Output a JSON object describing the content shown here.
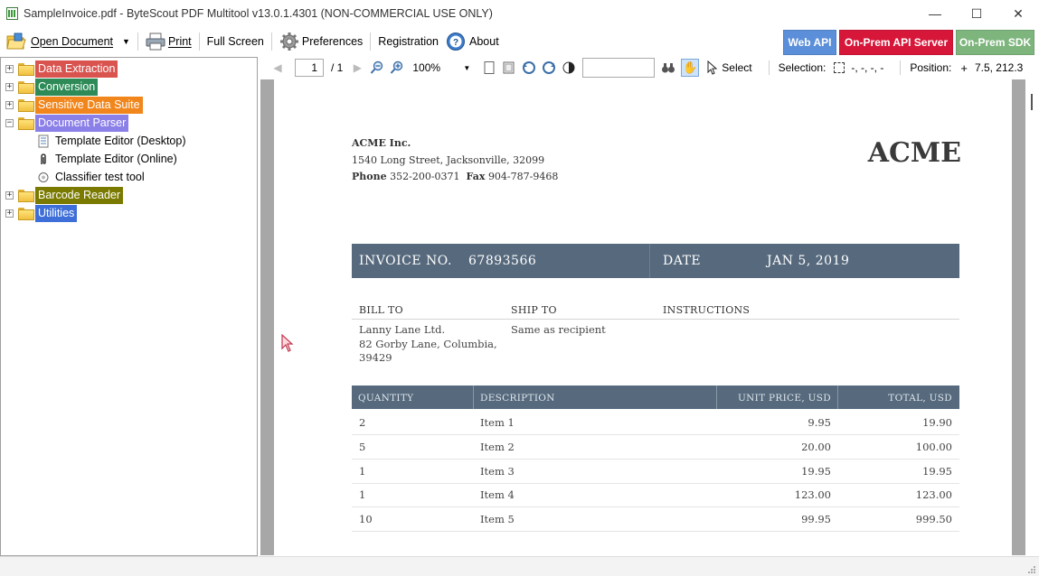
{
  "window": {
    "title": "SampleInvoice.pdf - ByteScout PDF Multitool v13.0.1.4301 (NON-COMMERCIAL USE ONLY)",
    "controls": {
      "minimize": "—",
      "maximize": "☐",
      "close": "✕"
    }
  },
  "toolbar": {
    "open_document": "Open Document",
    "print": "Print",
    "full_screen": "Full Screen",
    "preferences": "Preferences",
    "registration": "Registration",
    "about": "About",
    "web_api": "Web API",
    "on_prem_api_server": "On-Prem API Server",
    "on_prem_sdk": "On-Prem SDK"
  },
  "colors": {
    "web_api": "#5b8fd9",
    "on_prem_api_server": "#d7173a",
    "on_prem_sdk": "#7db57d",
    "invoice_band": "#56697d"
  },
  "tree": {
    "categories": [
      {
        "label": "Data Extraction",
        "bg": "#d9534f",
        "fg": "#ffffff",
        "expanded": false
      },
      {
        "label": "Conversion",
        "bg": "#2e8b57",
        "fg": "#ffffff",
        "expanded": false
      },
      {
        "label": "Sensitive Data Suite",
        "bg": "#f0861c",
        "fg": "#ffffff",
        "expanded": false
      },
      {
        "label": "Document Parser",
        "bg": "#8b7fe8",
        "fg": "#ffffff",
        "expanded": true,
        "children": [
          {
            "label": "Template Editor (Desktop)",
            "icon": "document-icon"
          },
          {
            "label": "Template Editor (Online)",
            "icon": "paperclip-icon"
          },
          {
            "label": "Classifier test tool",
            "icon": "gear-icon"
          }
        ]
      },
      {
        "label": "Barcode Reader",
        "bg": "#7a7a00",
        "fg": "#ffffff",
        "expanded": false
      },
      {
        "label": "Utilities",
        "bg": "#3e6fd8",
        "fg": "#ffffff",
        "expanded": false
      }
    ]
  },
  "pdf_toolbar": {
    "page_current": "1",
    "page_total": "/ 1",
    "zoom": "100%",
    "search_value": "",
    "select_label": "Select",
    "selection_label": "Selection:",
    "selection_value": "-, -, -, -",
    "position_label": "Position:",
    "position_value": "7.5, 212.3"
  },
  "invoice": {
    "company_name": "ACME Inc.",
    "address": "1540  Long Street, Jacksonville, 32099",
    "phone_label": "Phone",
    "phone": "352-200-0371",
    "fax_label": "Fax",
    "fax": "904-787-9468",
    "logo": "ACME",
    "invoice_no_label": "INVOICE NO.",
    "invoice_no": "67893566",
    "date_label": "DATE",
    "date": "JAN 5, 2019",
    "bill_to_label": "BILL TO",
    "ship_to_label": "SHIP TO",
    "instructions_label": "INSTRUCTIONS",
    "bill_to_lines": [
      "Lanny Lane Ltd.",
      "82  Gorby Lane, Columbia,",
      "39429"
    ],
    "ship_to": "Same as recipient",
    "table_headers": [
      "QUANTITY",
      "DESCRIPTION",
      "UNIT PRICE, USD",
      "TOTAL, USD"
    ],
    "rows": [
      {
        "qty": "2",
        "desc": "Item 1",
        "unit": "9.95",
        "total": "19.90"
      },
      {
        "qty": "5",
        "desc": "Item 2",
        "unit": "20.00",
        "total": "100.00"
      },
      {
        "qty": "1",
        "desc": "Item 3",
        "unit": "19.95",
        "total": "19.95"
      },
      {
        "qty": "1",
        "desc": "Item 4",
        "unit": "123.00",
        "total": "123.00"
      },
      {
        "qty": "10",
        "desc": "Item 5",
        "unit": "99.95",
        "total": "999.50"
      }
    ]
  }
}
